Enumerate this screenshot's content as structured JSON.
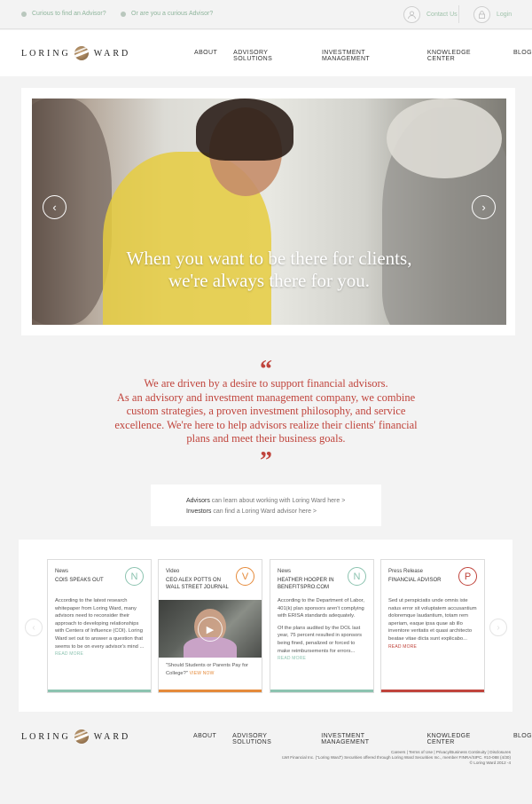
{
  "topbar": {
    "link1": "Curious to find an Advisor?",
    "link2": "Or are you a curious Advisor?",
    "contact": "Contact Us",
    "login": "Login"
  },
  "brand": {
    "left": "LORING",
    "right": "WARD"
  },
  "nav": [
    "ABOUT",
    "ADVISORY SOLUTIONS",
    "INVESTMENT MANAGEMENT",
    "KNOWLEDGE CENTER",
    "BLOG"
  ],
  "hero": {
    "line1": "When you want to be there for clients,",
    "line2": "we're always there for you."
  },
  "quote": {
    "open": "“",
    "close": "”",
    "line1": "We are driven by a desire to support financial advisors.",
    "line2": "As an advisory and investment management company, we combine",
    "line3": "custom strategies, a proven investment philosophy, and service",
    "line4": "excellence. We're here to help advisors realize their clients' financial",
    "line5": "plans and meet their business goals."
  },
  "advisors": {
    "adv_label": "Advisors",
    "adv_text": " can learn about working with Loring Ward here  >",
    "inv_label": "Investors",
    "inv_text": " can find a Loring Ward advisor here  >"
  },
  "cards": [
    {
      "type": "News",
      "title": "COIs SPEAKS OUT",
      "badge": "N",
      "color": "#8cc3b0",
      "body": "According to the latest research whitepaper from Loring Ward, many advisors need to reconsider their approach to developing relationships with Centers of Influence (COI). Loring Ward set out to answer a question that seems to be on every advisor's mind ...",
      "more": "READ MORE"
    },
    {
      "type": "Video",
      "title": "CEO ALEX POTTS ON WALL STREET JOURNAL",
      "badge": "V",
      "color": "#e58a3a",
      "body": "\"Should Students or Parents Pay for College?\"",
      "more": "VIEW NOW"
    },
    {
      "type": "News",
      "title": "HEATHER HOOPER IN BENEFITSPRO.COM",
      "badge": "N",
      "color": "#8cc3b0",
      "body": "According to the Department of Labor, 401(k) plan sponsors aren't complying with ERISA standards adequately.",
      "body2": "Of the plans audited by the DOL last year, 75 percent resulted in sponsors being fined, penalized or forced to make reimbursements for errors...",
      "more": "READ MORE"
    },
    {
      "type": "Press Release",
      "title": "FINANCIAL ADVISOR",
      "badge": "P",
      "color": "#c0443c",
      "body": "Sed ut perspiciatis unde omnis iste natus error sit voluptatem accusantium doloremque laudantium, totam rem aperiam, eaque ipsa quae ab illo inventore veritatis et quasi architecto beatae vitae dicta sunt explicabo...",
      "more": "READ MORE"
    }
  ],
  "footer": {
    "links": "Careers | Terms of Use | Privacy/Business Continuity | Disclosures",
    "legal": "LWI Financial Inc. (\"Loring Ward\") Securities offered through Loring Ward Securities Inc., member FINRA/SIPC. #10-088 (4/30)",
    "copyright": "© Loring Ward 2012 -4"
  },
  "colors": {
    "accent_red": "#c0443c",
    "accent_green": "#8fb59c",
    "accent_orange": "#e58a3a"
  }
}
